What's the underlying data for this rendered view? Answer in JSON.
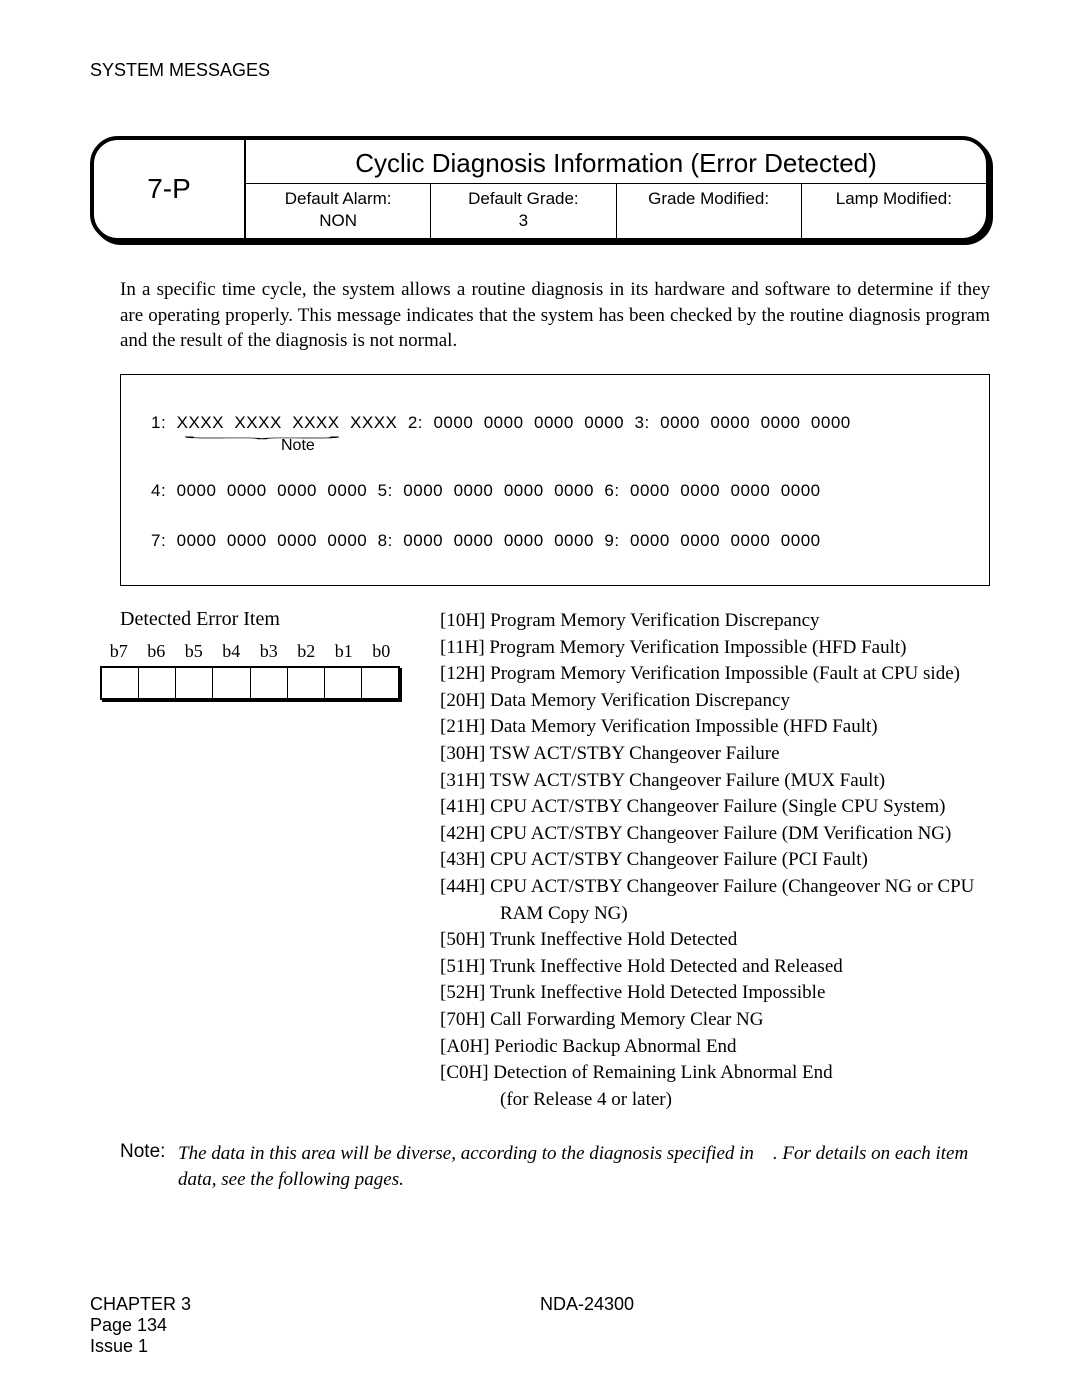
{
  "running_head": "SYSTEM MESSAGES",
  "header": {
    "code": "7-P",
    "title": "Cyclic Diagnosis Information (Error Detected)",
    "meta": {
      "c1l": "Default Alarm:",
      "c1v": "NON",
      "c2l": "Default Grade:",
      "c2v": "3",
      "c3l": "Grade Modified:",
      "c3v": "",
      "c4l": "Lamp Modified:",
      "c4v": ""
    }
  },
  "intro": "In a specific time cycle, the system allows a routine diagnosis in its hardware and software to determine if they are operating properly. This message indicates that the system has been checked by the routine diagnosis program and the result of the diagnosis is not normal.",
  "data": {
    "line1": "1:  XXXX  XXXX  XXXX  XXXX  2:  0000  0000  0000  0000  3:  0000  0000  0000  0000",
    "note_under": "Note",
    "line2": "4:  0000  0000  0000  0000  5:  0000  0000  0000  0000  6:  0000  0000  0000  0000",
    "line3": "7:  0000  0000  0000  0000  8:  0000  0000  0000  0000  9:  0000  0000  0000  0000"
  },
  "dei_title": "Detected Error Item",
  "bits": [
    "b7",
    "b6",
    "b5",
    "b4",
    "b3",
    "b2",
    "b1",
    "b0"
  ],
  "codes": [
    "[10H] Program Memory Verification Discrepancy",
    "[11H] Program Memory Verification Impossible (HFD Fault)",
    "[12H] Program Memory Verification Impossible (Fault at CPU side)",
    "[20H] Data Memory Verification Discrepancy",
    "[21H] Data Memory Verification Impossible (HFD Fault)",
    "[30H] TSW ACT/STBY Changeover Failure",
    "[31H] TSW ACT/STBY Changeover Failure (MUX Fault)",
    "[41H] CPU ACT/STBY Changeover Failure (Single CPU System)",
    "[42H] CPU ACT/STBY Changeover Failure (DM Verification NG)",
    "[43H] CPU ACT/STBY Changeover Failure (PCI Fault)",
    "[44H] CPU ACT/STBY Changeover Failure (Changeover NG or CPU"
  ],
  "codes_indent1": "RAM Copy NG)",
  "codes2": [
    "[50H] Trunk Ineffective Hold Detected",
    "[51H] Trunk Ineffective Hold Detected and Released",
    "[52H] Trunk Ineffective Hold Detected Impossible",
    "[70H] Call Forwarding Memory Clear NG",
    "[A0H] Periodic Backup Abnormal End",
    "[C0H] Detection of Remaining Link Abnormal End"
  ],
  "codes_indent2": "(for Release 4 or later)",
  "note": {
    "label": "Note:",
    "body": "The data in this area will be diverse, according to the diagnosis specified in    . For details on each item data, see the following pages."
  },
  "footer": {
    "chapter": "CHAPTER 3",
    "page": "Page 134",
    "issue": "Issue 1",
    "doc": "NDA-24300"
  }
}
